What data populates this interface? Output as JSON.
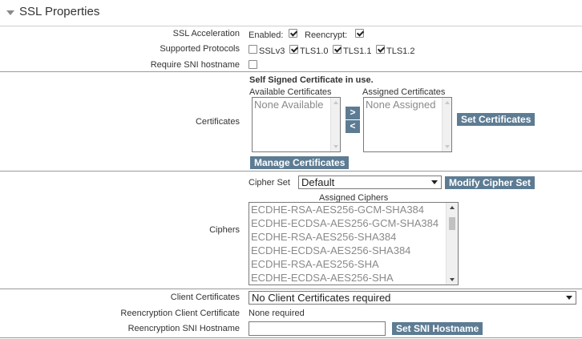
{
  "section": {
    "title": "SSL Properties"
  },
  "ssl_acceleration": {
    "label": "SSL Acceleration",
    "enabled_label": "Enabled:",
    "enabled": true,
    "reencrypt_label": "Reencrypt:",
    "reencrypt": true
  },
  "protocols": {
    "label": "Supported Protocols",
    "items": [
      {
        "label": "SSLv3",
        "checked": false
      },
      {
        "label": "TLS1.0",
        "checked": true
      },
      {
        "label": "TLS1.1",
        "checked": true
      },
      {
        "label": "TLS1.2",
        "checked": true
      }
    ]
  },
  "sni": {
    "label": "Require SNI hostname",
    "checked": false
  },
  "certificates": {
    "label": "Certificates",
    "notice": "Self Signed Certificate in use.",
    "available_label": "Available Certificates",
    "available_items": [
      "None Available"
    ],
    "assigned_label": "Assigned Certificates",
    "assigned_items": [
      "None Assigned"
    ],
    "move_right": ">",
    "move_left": "<",
    "set_button": "Set Certificates",
    "manage_button": "Manage Certificates"
  },
  "ciphers": {
    "label": "Ciphers",
    "cipher_set_label": "Cipher Set",
    "cipher_set_value": "Default",
    "modify_button": "Modify Cipher Set",
    "assigned_label": "Assigned Ciphers",
    "items": [
      "ECDHE-RSA-AES256-GCM-SHA384",
      "ECDHE-ECDSA-AES256-GCM-SHA384",
      "ECDHE-RSA-AES256-SHA384",
      "ECDHE-ECDSA-AES256-SHA384",
      "ECDHE-RSA-AES256-SHA",
      "ECDHE-ECDSA-AES256-SHA"
    ]
  },
  "client_certificates": {
    "label": "Client Certificates",
    "value": "No Client Certificates required"
  },
  "reencryption_cert": {
    "label": "Reencryption Client Certificate",
    "value": "None required"
  },
  "reencryption_sni": {
    "label": "Reencryption SNI Hostname",
    "value": "",
    "button": "Set SNI Hostname"
  },
  "icons": {
    "collapse": "collapse-triangle-icon",
    "dropdown": "chevron-down-icon"
  },
  "colors": {
    "button": "#5d7c93",
    "button_text": "#ffffff",
    "list_text": "#8a8a8a"
  }
}
